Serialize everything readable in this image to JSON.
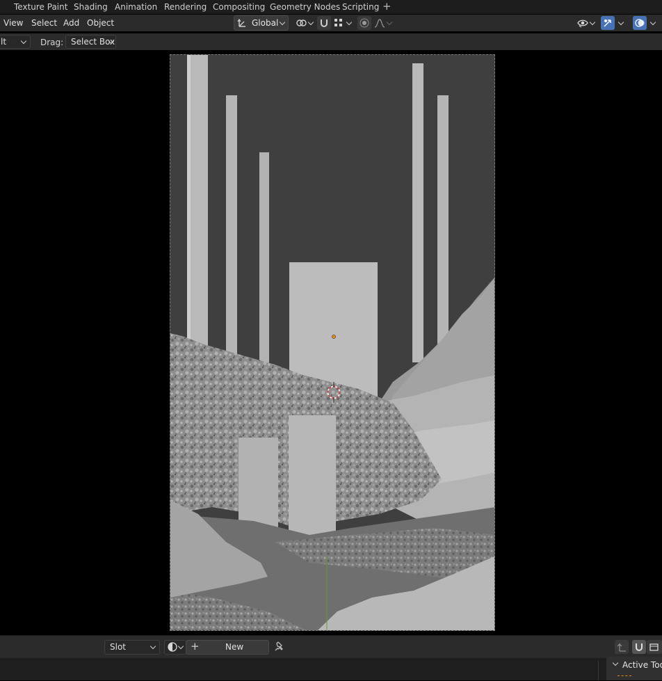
{
  "workspace_tabs": [
    "Texture Paint",
    "Shading",
    "Animation",
    "Rendering",
    "Compositing",
    "Geometry Nodes",
    "Scripting"
  ],
  "add_workspace_label": "+",
  "header": {
    "menus": [
      "View",
      "Select",
      "Add",
      "Object"
    ],
    "orientation": "Global"
  },
  "tool_settings": {
    "mode_value": "lt",
    "drag_label": "Drag:",
    "drag_value": "Select Box"
  },
  "bottom_header": {
    "slot_value": "Slot",
    "add_icon": "+",
    "new_label": "New"
  },
  "sidebar": {
    "active_tool_label": "Active Tool"
  },
  "colors": {
    "accent_blue": "#4772b3",
    "header_bg": "#2b2b2b",
    "topbar_bg": "#1d1d1d",
    "sky": "#3e3e3e",
    "mesh_light": "#b9b9b9",
    "origin_orange": "#e98a1c",
    "cursor_red": "#d94040",
    "y_axis_green": "#6b9a2e"
  }
}
